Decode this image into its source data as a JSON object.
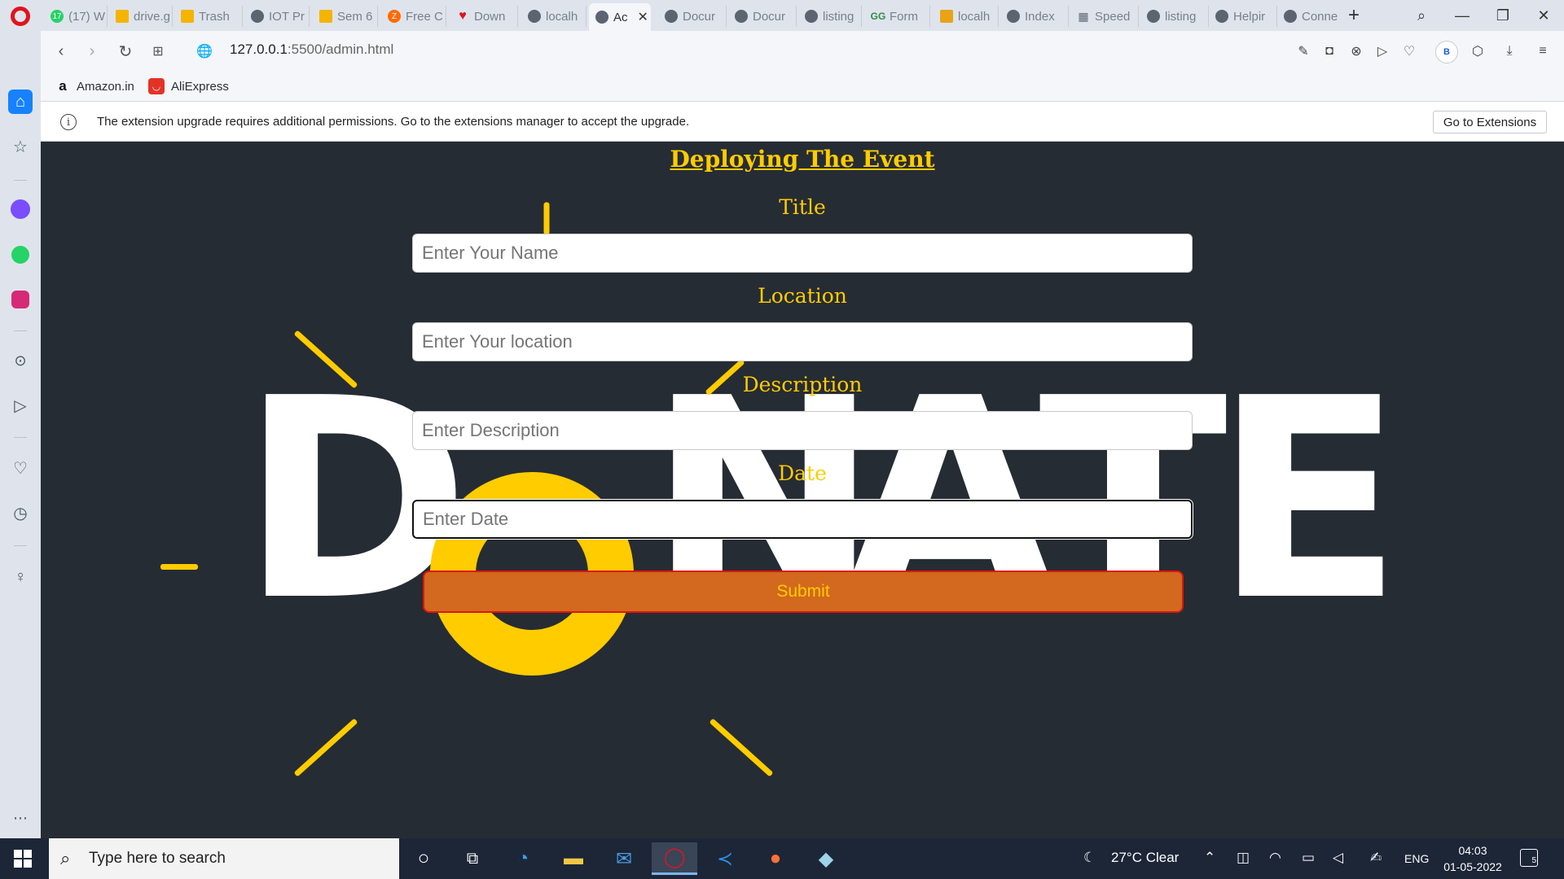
{
  "browser": {
    "tabs": [
      {
        "label": "(17) W",
        "icon": "whatsapp-icon",
        "color": "#25d366"
      },
      {
        "label": "drive.g",
        "icon": "drive-icon",
        "color": "#f4b400"
      },
      {
        "label": "Trash",
        "icon": "drive-icon",
        "color": "#f4b400"
      },
      {
        "label": "IOT Pr",
        "icon": "globe-icon",
        "color": "#5b6470"
      },
      {
        "label": "Sem 6",
        "icon": "drive-icon",
        "color": "#f4b400"
      },
      {
        "label": "Free C",
        "icon": "zapier-icon",
        "color": "#ff6a00"
      },
      {
        "label": "Down",
        "icon": "heart-icon",
        "color": "#e0141e"
      },
      {
        "label": "localh",
        "icon": "globe-icon",
        "color": "#5b6470"
      },
      {
        "label": "Ac",
        "icon": "globe-icon",
        "color": "#5b6470",
        "active": true
      },
      {
        "label": "Docur",
        "icon": "globe-icon",
        "color": "#5b6470"
      },
      {
        "label": "Docur",
        "icon": "globe-icon",
        "color": "#5b6470"
      },
      {
        "label": "listing",
        "icon": "globe-icon",
        "color": "#5b6470"
      },
      {
        "label": "Form",
        "icon": "geeks-icon",
        "color": "#2f8d46"
      },
      {
        "label": "localh",
        "icon": "pma-icon",
        "color": "#e8a317"
      },
      {
        "label": "Index",
        "icon": "globe-icon",
        "color": "#5b6470"
      },
      {
        "label": "Speed",
        "icon": "grid-icon",
        "color": "#5b6470"
      },
      {
        "label": "listing",
        "icon": "globe-icon",
        "color": "#5b6470"
      },
      {
        "label": "Helpir",
        "icon": "globe-icon",
        "color": "#5b6470"
      },
      {
        "label": "Conne",
        "icon": "globe-icon",
        "color": "#5b6470"
      }
    ],
    "url_host": "127.0.0.1",
    "url_rest": ":5500/admin.html",
    "profile_initial": "B",
    "bookmarks": [
      {
        "label": "Amazon.in",
        "icon": "amazon-icon"
      },
      {
        "label": "AliExpress",
        "icon": "aliexpress-icon"
      }
    ],
    "infobar": {
      "message": "The extension upgrade requires additional permissions. Go to the extensions manager to accept the upgrade.",
      "button": "Go to Extensions"
    }
  },
  "page": {
    "heading": "Deploying The Event",
    "background_word": "DONATE",
    "fields": [
      {
        "label": "Title",
        "placeholder": "Enter Your Name"
      },
      {
        "label": "Location",
        "placeholder": "Enter Your location"
      },
      {
        "label": "Description",
        "placeholder": "Enter Description"
      },
      {
        "label": "Date",
        "placeholder": "Enter Date"
      }
    ],
    "submit": "Submit",
    "colors": {
      "accent": "#ffcc00",
      "button": "#d2691e",
      "button_border": "#e0140a",
      "background": "#262c34"
    }
  },
  "taskbar": {
    "search_placeholder": "Type here to search",
    "weather": "27°C  Clear",
    "language": "ENG",
    "time": "04:03",
    "date": "01-05-2022",
    "notification_count": "5"
  }
}
